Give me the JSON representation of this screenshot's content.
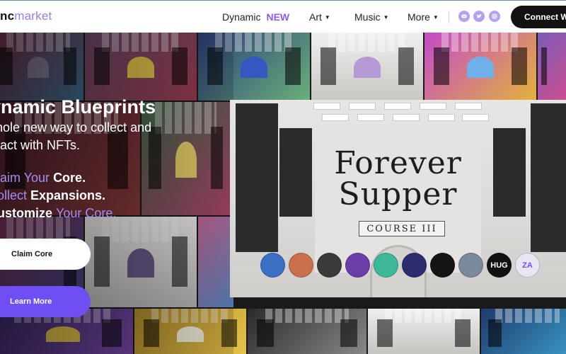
{
  "nav": {
    "logo_bold": "nc",
    "logo_light": "market",
    "items": [
      {
        "label": "Dynamic",
        "badge": "NEW"
      },
      {
        "label": "Art"
      },
      {
        "label": "Music"
      },
      {
        "label": "More"
      }
    ],
    "social_icons": [
      "discord-icon",
      "twitter-icon",
      "instagram-icon"
    ],
    "connect_label": "Connect W"
  },
  "hero": {
    "title": "ynamic Blueprints",
    "subtitle_line1": "hole new way to collect and",
    "subtitle_line2": "ract with NFTs.",
    "claims": [
      {
        "accent": "laim Your ",
        "strong": "Core."
      },
      {
        "accent": "ollect ",
        "strong": "Expansions."
      },
      {
        "strong": "ustomize ",
        "accent": "Your Core."
      }
    ],
    "claim_button": "Claim Core",
    "learn_button": "Learn More"
  },
  "feature": {
    "title_line1": "Forever",
    "title_line2": "Supper",
    "badge": "COURSE III",
    "avatars": [
      {
        "label": "",
        "color": "#3a6fc4"
      },
      {
        "label": "",
        "color": "#c96f4a"
      },
      {
        "label": "",
        "color": "#3a3a3a"
      },
      {
        "label": "",
        "color": "#6a3ea8"
      },
      {
        "label": "",
        "color": "#3fb89a"
      },
      {
        "label": "",
        "color": "#2c2c6e"
      },
      {
        "label": "",
        "color": "#151515"
      },
      {
        "label": "",
        "color": "#7a8a9a"
      },
      {
        "label": "HUG",
        "color": "#111111"
      },
      {
        "label": "ZA",
        "color": "#e8e6f5"
      }
    ]
  },
  "colors": {
    "accent": "#6f4ef3",
    "accent_light": "#a58cf5",
    "nav_badge": "#8b5cf6"
  }
}
